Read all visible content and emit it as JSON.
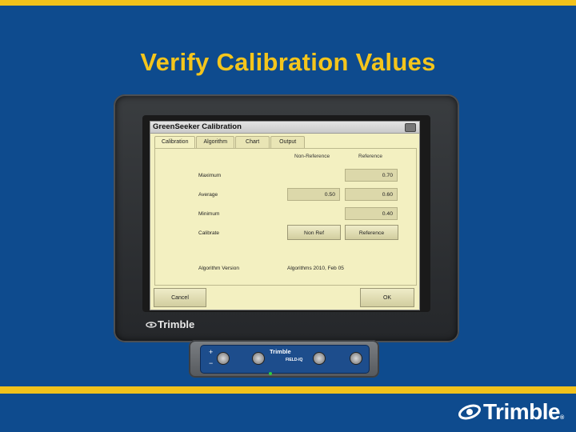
{
  "slide": {
    "title": "Verify Calibration Values",
    "brand": "Trimble",
    "brand_reg": "®",
    "colors": {
      "background": "#0e4b8e",
      "accent": "#f2c21b",
      "title": "#f4c51c"
    }
  },
  "device": {
    "logo": "Trimble",
    "controller_logo": "Trimble",
    "controller_model": "FIELD-IQ"
  },
  "window": {
    "title": "GreenSeeker Calibration",
    "tabs": [
      {
        "label": "Calibration",
        "active": true
      },
      {
        "label": "Algorithm",
        "active": false
      },
      {
        "label": "Chart",
        "active": false
      },
      {
        "label": "Output",
        "active": false
      }
    ],
    "columns": {
      "non_reference": "Non-Reference",
      "reference": "Reference"
    },
    "rows": {
      "maximum": {
        "label": "Maximum",
        "reference": "0.70"
      },
      "average": {
        "label": "Average",
        "non_reference": "0.50",
        "reference": "0.60"
      },
      "minimum": {
        "label": "Minimum",
        "reference": "0.40"
      },
      "calibrate": {
        "label": "Calibrate",
        "non_ref_button": "Non Ref",
        "reference_button": "Reference"
      }
    },
    "algorithm_version": {
      "label": "Algorithm Version",
      "value": "Algorithms 2010, Feb 05"
    },
    "footer": {
      "cancel": "Cancel",
      "ok": "OK"
    }
  }
}
